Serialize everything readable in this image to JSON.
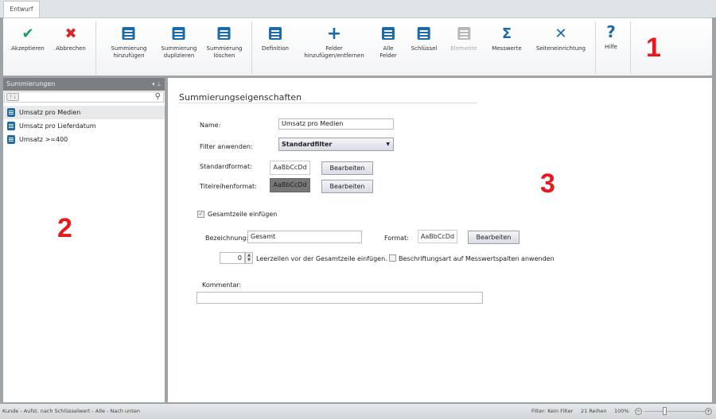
{
  "tabs": [
    {
      "label": "Entwurf"
    }
  ],
  "ribbon": {
    "buttons": [
      {
        "label": "Akzeptieren",
        "icon": "check-icon",
        "color": "#1aa05a"
      },
      {
        "label": "Abbrechen",
        "icon": "close-icon",
        "color": "#d42a2a"
      },
      {
        "label": "Summierung\nhinzufügen",
        "icon": "add-summary-icon"
      },
      {
        "label": "Summierung\nduplizieren",
        "icon": "duplicate-summary-icon"
      },
      {
        "label": "Summierung\nlöschen",
        "icon": "delete-summary-icon"
      },
      {
        "label": "Definition",
        "icon": "definition-icon"
      },
      {
        "label": "Felder\nhinzufügen/entfernen",
        "icon": "plus-icon"
      },
      {
        "label": "Alle\nFelder",
        "icon": "all-fields-icon"
      },
      {
        "label": "Schlüssel",
        "icon": "key-icon"
      },
      {
        "label": "Elemente",
        "icon": "elements-icon",
        "disabled": true
      },
      {
        "label": "Messwerte",
        "icon": "sigma-icon"
      },
      {
        "label": "Seiteneinrichtung",
        "icon": "page-setup-icon"
      },
      {
        "label": "Hilfe",
        "icon": "help-icon"
      }
    ]
  },
  "annotations": {
    "n1": "1",
    "n2": "2",
    "n3": "3"
  },
  "sidebar": {
    "title": "Summierungen",
    "search_value": "",
    "items": [
      {
        "label": "Umsatz pro Medien",
        "selected": true
      },
      {
        "label": "Umsatz pro Lieferdatum"
      },
      {
        "label": "Umsatz >=400"
      }
    ]
  },
  "main": {
    "title": "Summierungseigenschaften",
    "name_label": "Name:",
    "name_value": "Umsatz pro Medien",
    "filter_label": "Filter anwenden:",
    "filter_value": "Standardfilter",
    "stdformat_label": "Standardformat:",
    "sample": "AaBbCcDd",
    "titleformat_label": "Titelreihenformat:",
    "edit_label": "Bearbeiten",
    "total_checkbox_label": "Gesamtzeile einfügen",
    "total_checked": true,
    "designation_label": "Bezeichnung:",
    "designation_value": "Gesamt",
    "format_label": "Format:",
    "blank_rows_value": "0",
    "blank_rows_label": "Leerzeilen vor der Gesamtzeile einfügen.",
    "caption_checkbox_label": "Beschriftungsart auf Messwertspalten anwenden",
    "caption_checked": false,
    "comment_label": "Kommentar:",
    "comment_value": ""
  },
  "status": {
    "left": "Kunde - Aufst. nach Schlüsselwert - Alle - Nach unten",
    "filter": "Filter: Kein Filter",
    "rows": "21 Reihen",
    "zoom": "100%",
    "zoom_percent": 100
  }
}
